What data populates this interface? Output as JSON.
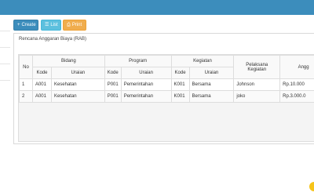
{
  "toolbar": {
    "create_label": "Create",
    "list_label": "List",
    "print_label": "Print"
  },
  "panel": {
    "title": "Rencana Anggaran Biaya (RAB)"
  },
  "table": {
    "headers": {
      "no": "No",
      "bidang": "Bidang",
      "program": "Program",
      "kegiatan": "Kegiatan",
      "pelaksana": "Pelaksana Kegiatan",
      "anggaran": "Angg"
    },
    "subheaders": {
      "kode": "Kode",
      "uraian": "Uraian"
    },
    "rows": [
      {
        "no": "1",
        "bidang_kode": "A001",
        "bidang_uraian": "Kesehatan",
        "program_kode": "P001",
        "program_uraian": "Pemerintahan",
        "kegiatan_kode": "K001",
        "kegiatan_uraian": "Bersama",
        "pelaksana": "Johnson",
        "anggaran": "Rp.10.000"
      },
      {
        "no": "2",
        "bidang_kode": "A001",
        "bidang_uraian": "Kesehatan",
        "program_kode": "P001",
        "program_uraian": "Pemerintahan",
        "kegiatan_kode": "K001",
        "kegiatan_uraian": "Bersama",
        "pelaksana": "joko",
        "anggaran": "Rp.3.000.0"
      }
    ]
  },
  "colors": {
    "header_bar": "#3c8dbc",
    "btn_create": "#3c8dbc",
    "btn_list": "#5dc0de",
    "btn_print": "#f0ad4e",
    "float_button": "#f6c41a"
  },
  "icons": {
    "create": "plus-icon",
    "list": "list-icon",
    "print": "print-icon"
  }
}
